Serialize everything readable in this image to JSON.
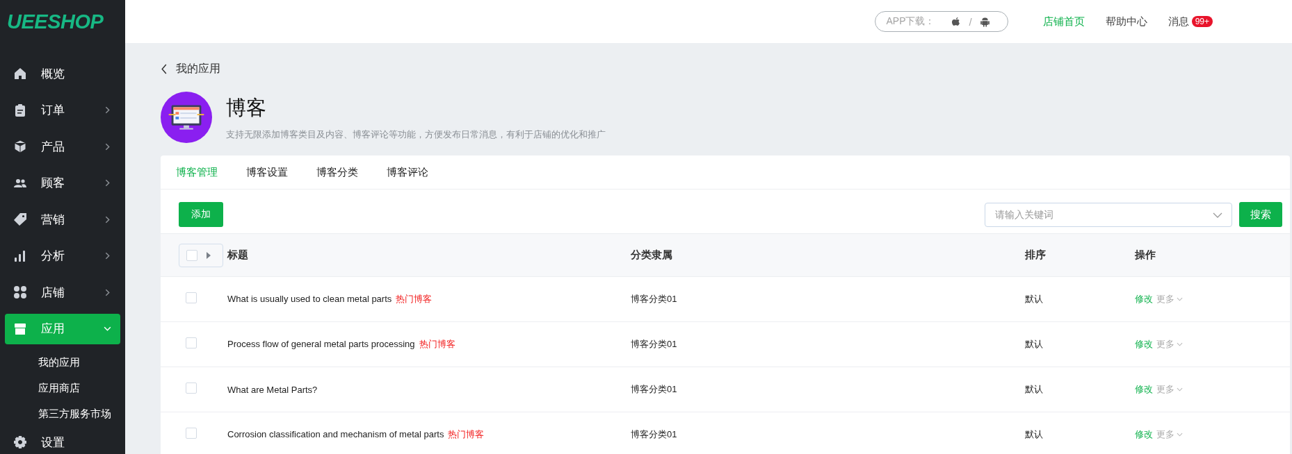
{
  "sidebar": {
    "logo": "UEESHOP",
    "items": [
      {
        "label": "概览",
        "selected": false
      },
      {
        "label": "订单",
        "selected": false,
        "expanded": false
      },
      {
        "label": "产品",
        "selected": false,
        "expanded": false
      },
      {
        "label": "顾客",
        "selected": false,
        "expanded": false
      },
      {
        "label": "营销",
        "selected": false,
        "expanded": false
      },
      {
        "label": "分析",
        "selected": false,
        "expanded": false
      },
      {
        "label": "店铺",
        "selected": false,
        "expanded": false
      },
      {
        "label": "应用",
        "selected": true,
        "expanded": true,
        "children": [
          {
            "label": "我的应用"
          },
          {
            "label": "应用商店"
          },
          {
            "label": "第三方服务市场"
          }
        ]
      },
      {
        "label": "设置",
        "selected": false
      }
    ]
  },
  "topbar": {
    "app_download": "APP下载：",
    "separator": "/",
    "links": [
      {
        "label": "店铺首页",
        "selected": true
      },
      {
        "label": "帮助中心",
        "selected": false
      },
      {
        "label": "消息",
        "selected": false,
        "badge": "99+"
      }
    ]
  },
  "breadcrumb": {
    "back": "我的应用"
  },
  "app": {
    "title": "博客",
    "description": "支持无限添加博客类目及内容、博客评论等功能，方便发布日常消息，有利于店铺的优化和推广"
  },
  "tabs": [
    {
      "label": "博客管理",
      "selected": true
    },
    {
      "label": "博客设置",
      "selected": false
    },
    {
      "label": "博客分类",
      "selected": false
    },
    {
      "label": "博客评论",
      "selected": false
    }
  ],
  "toolbar": {
    "add_button": "添加",
    "search": {
      "placeholder": "请输入关键词"
    },
    "search_button": "搜索"
  },
  "table": {
    "header_checked": false,
    "columns": [
      "标题",
      "分类隶属",
      "排序",
      "操作"
    ],
    "rows": [
      {
        "checked": false,
        "title": "What is usually used to clean metal parts",
        "tag": "热门博客",
        "category": "博客分类01",
        "sort": "默认",
        "edit": "修改",
        "more": "更多"
      },
      {
        "checked": false,
        "title": "Process flow of general metal parts processing",
        "tag": "热门博客",
        "category": "博客分类01",
        "sort": "默认",
        "edit": "修改",
        "more": "更多"
      },
      {
        "checked": false,
        "title": "What are Metal Parts?",
        "category": "博客分类01",
        "sort": "默认",
        "edit": "修改",
        "more": "更多"
      },
      {
        "checked": false,
        "title": "Corrosion classification and mechanism of metal parts",
        "tag": "热门博客",
        "category": "博客分类01",
        "sort": "默认",
        "edit": "修改",
        "more": "更多"
      }
    ]
  }
}
